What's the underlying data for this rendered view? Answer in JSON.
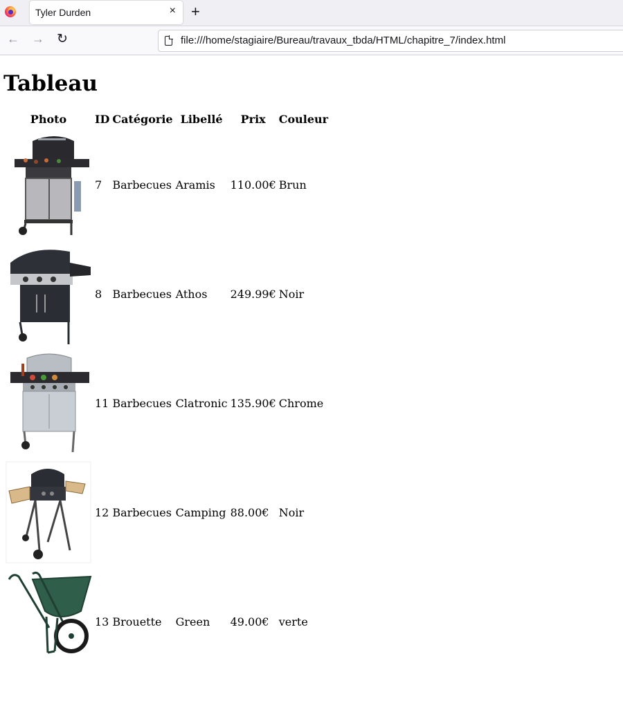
{
  "browser": {
    "tab_title": "Tyler Durden",
    "tab_close": "×",
    "new_tab": "+",
    "back": "←",
    "forward": "→",
    "reload": "↻",
    "url": "file:///home/stagiaire/Bureau/travaux_tbda/HTML/chapitre_7/index.html"
  },
  "page": {
    "heading": "Tableau",
    "columns": [
      "Photo",
      "ID",
      "Catégorie",
      "Libellé",
      "Prix",
      "Couleur"
    ],
    "rows": [
      {
        "id": "7",
        "category": "Barbecues",
        "label": "Aramis",
        "price": "110.00€",
        "color": "Brun",
        "image": "gas-barbecue-grill-image"
      },
      {
        "id": "8",
        "category": "Barbecues",
        "label": "Athos",
        "price": "249.99€",
        "color": "Noir",
        "image": "black-gas-barbecue-image"
      },
      {
        "id": "11",
        "category": "Barbecues",
        "label": "Clatronic",
        "price": "135.90€",
        "color": "Chrome",
        "image": "chrome-gas-barbecue-image"
      },
      {
        "id": "12",
        "category": "Barbecues",
        "label": "Camping",
        "price": "88.00€",
        "color": "Noir",
        "image": "camping-barbecue-image"
      },
      {
        "id": "13",
        "category": "Brouette",
        "label": "Green",
        "price": "49.00€",
        "color": "verte",
        "image": "green-wheelbarrow-image"
      }
    ]
  }
}
